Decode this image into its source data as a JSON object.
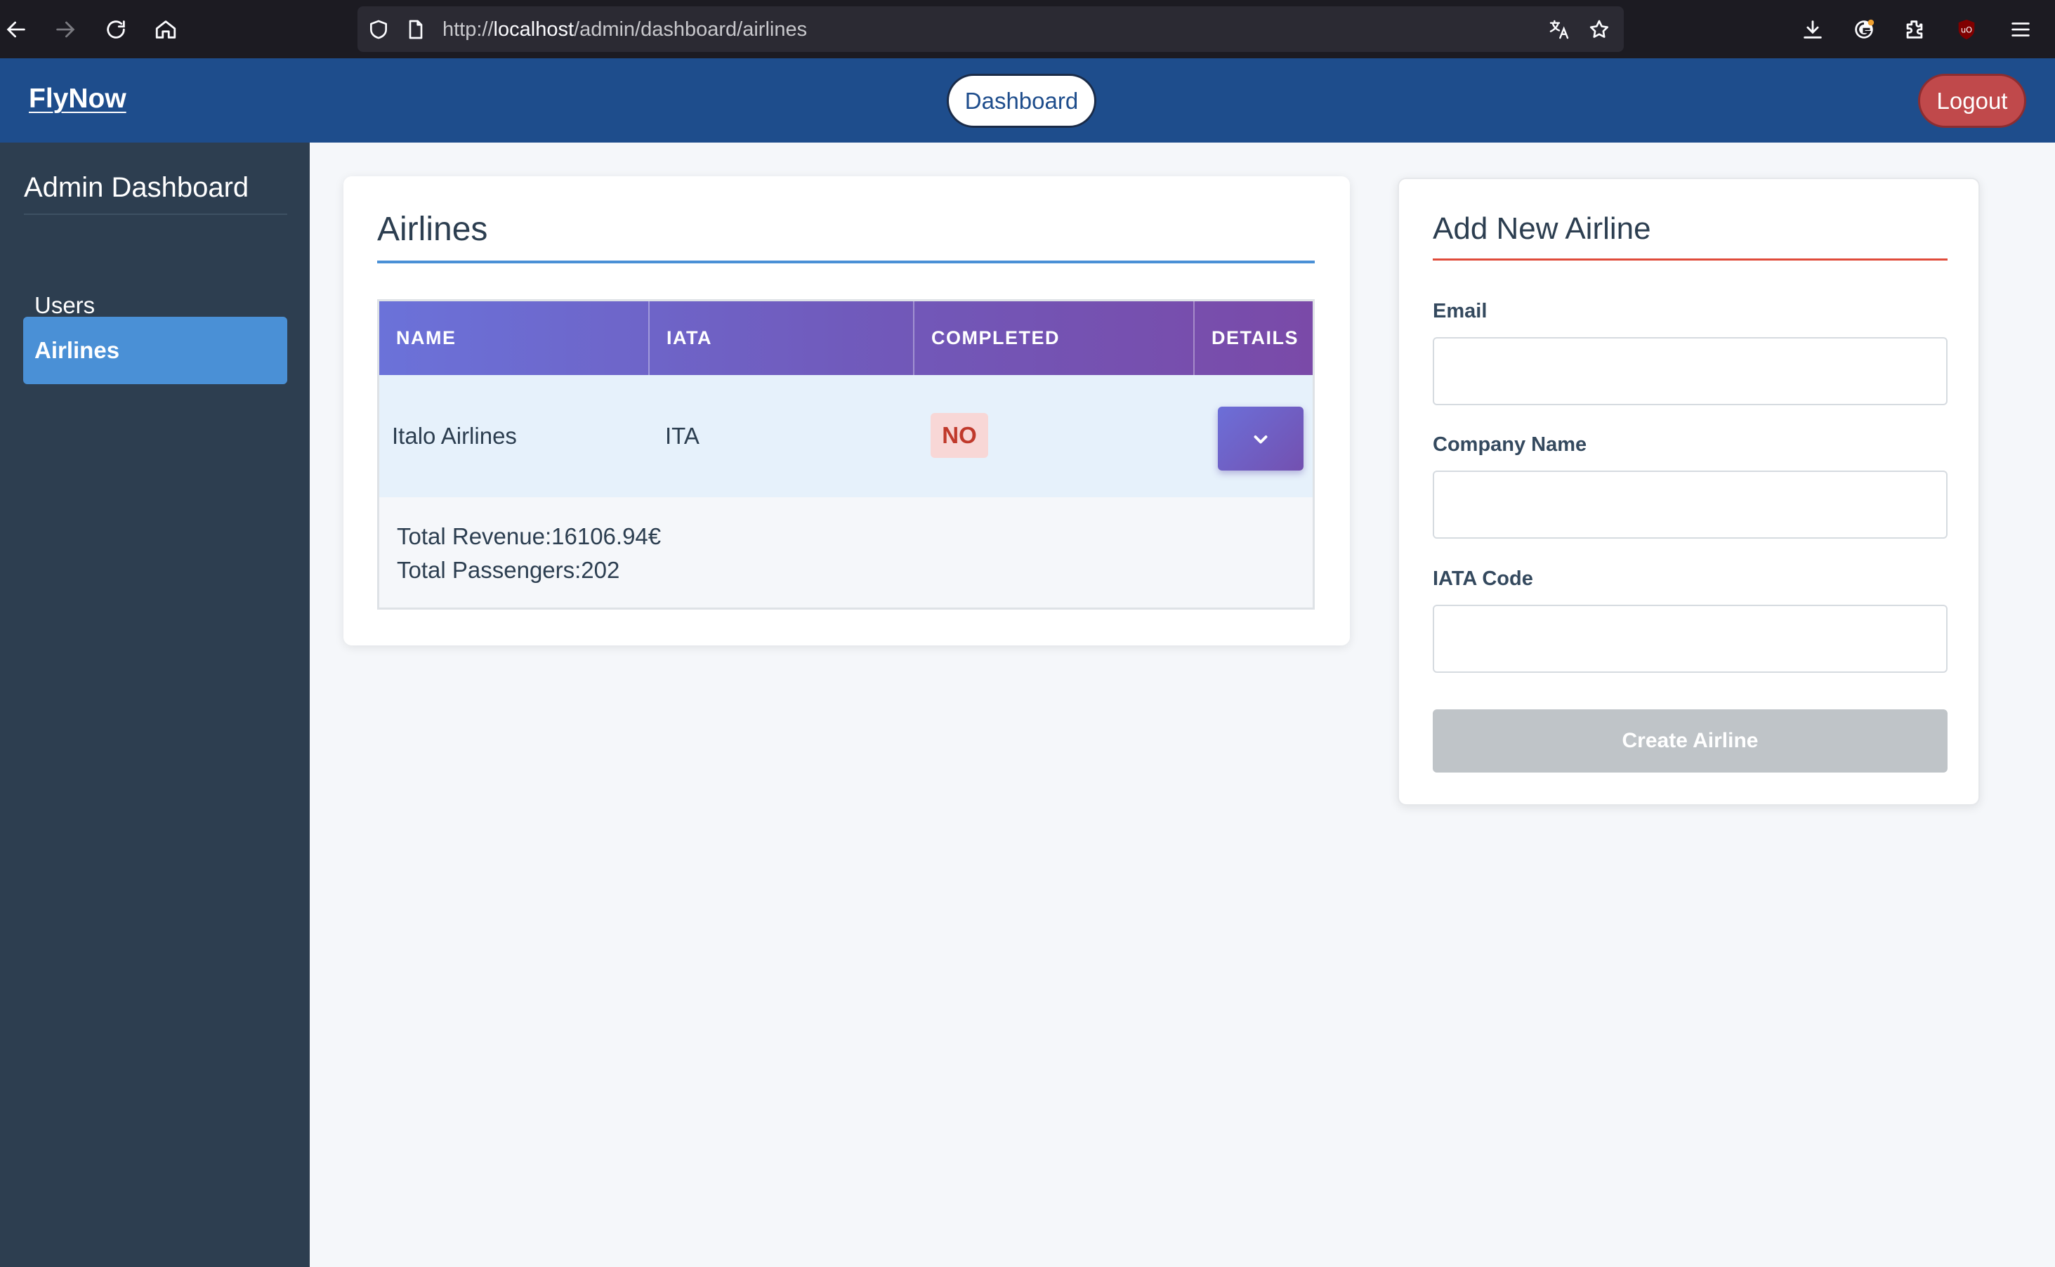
{
  "browser": {
    "url_prefix": "http://",
    "url_host": "localhost",
    "url_path": "/admin/dashboard/airlines",
    "icons": [
      "back-icon",
      "forward-icon",
      "reload-icon",
      "home-icon",
      "shield-icon",
      "page-icon",
      "translate-icon",
      "star-icon",
      "download-icon",
      "account-icon",
      "extensions-icon",
      "ublock-icon",
      "menu-icon"
    ]
  },
  "header": {
    "brand": "FlyNow",
    "dashboard_label": "Dashboard",
    "logout_label": "Logout"
  },
  "sidebar": {
    "title": "Admin Dashboard",
    "items": [
      {
        "label": "Users",
        "active": false
      },
      {
        "label": "Airlines",
        "active": true
      }
    ]
  },
  "airlines": {
    "title": "Airlines",
    "columns": [
      "NAME",
      "IATA",
      "COMPLETED",
      "DETAILS"
    ],
    "rows": [
      {
        "name": "Italo Airlines",
        "iata": "ITA",
        "completed": "NO",
        "details": {
          "revenue": "Total Revenue:16106.94€",
          "passengers": "Total Passengers:202"
        }
      }
    ]
  },
  "add_airline": {
    "title": "Add New Airline",
    "email_label": "Email",
    "email_value": "",
    "company_label": "Company Name",
    "company_value": "",
    "iata_label": "IATA Code",
    "iata_value": "",
    "submit_label": "Create Airline"
  },
  "colors": {
    "header_bg": "#1e4d8c",
    "sidebar_bg": "#2d3e50",
    "sidebar_active": "#4a90d6",
    "airlines_underline": "#4a90d6",
    "add_underline": "#e04b3a",
    "logout_bg": "#c0494b",
    "badge_no_text": "#c0392b",
    "badge_no_bg": "#f8d7d6",
    "button_disabled": "#bfc4c8"
  }
}
